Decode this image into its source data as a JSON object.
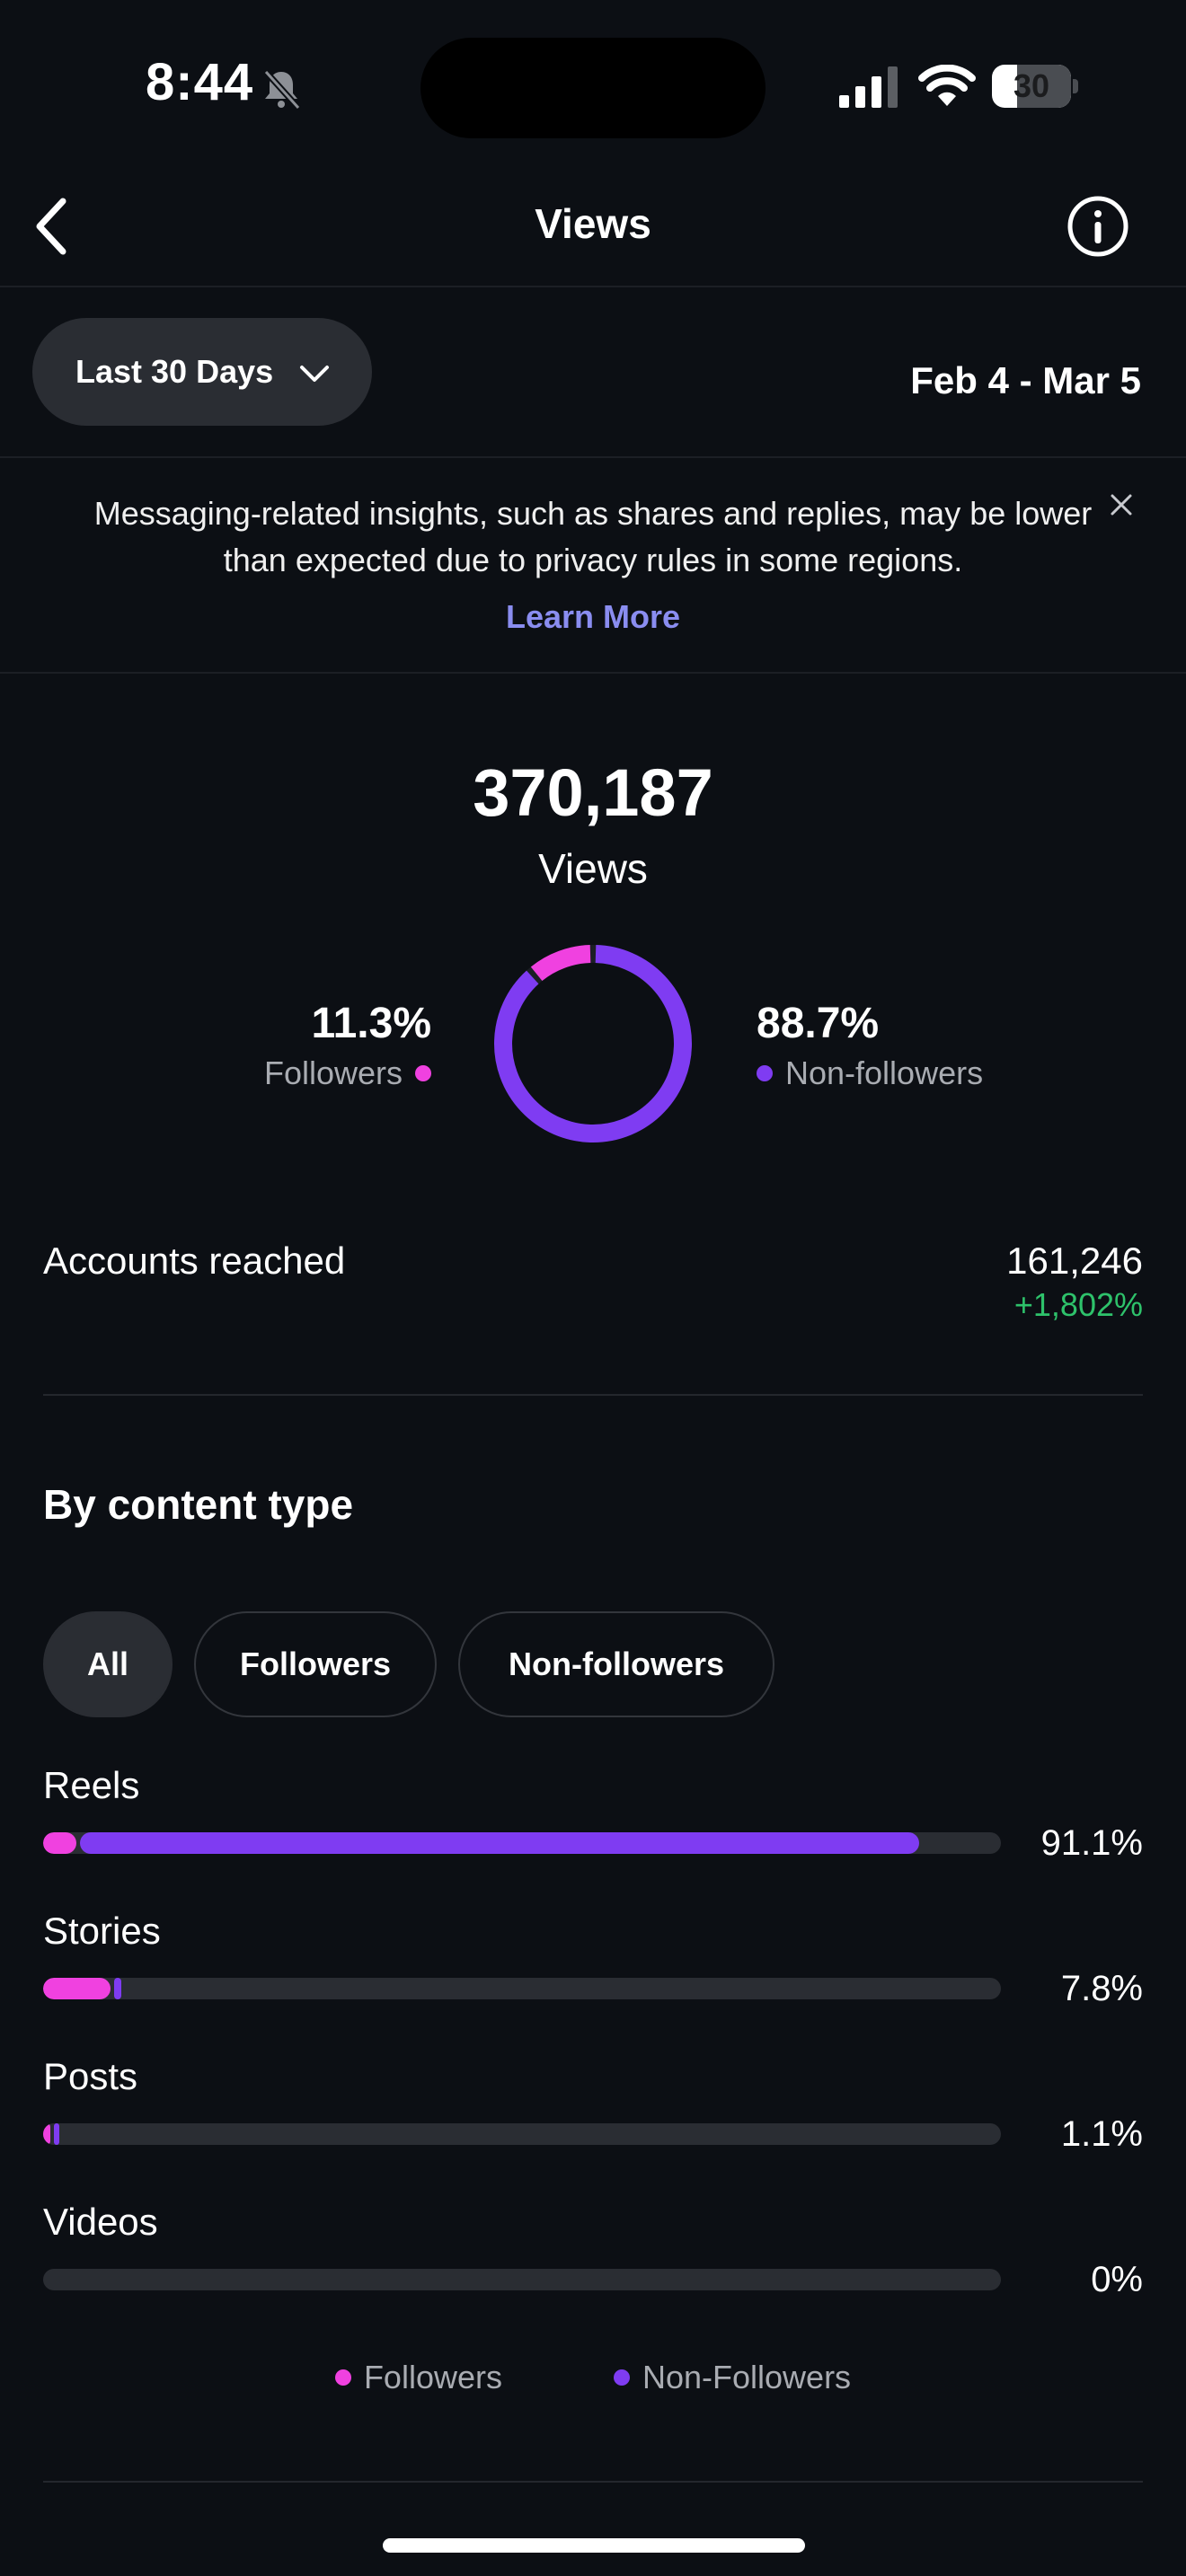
{
  "status_bar": {
    "time": "8:44",
    "battery": "30"
  },
  "header": {
    "title": "Views"
  },
  "filter": {
    "range_label": "Last 30 Days",
    "date_range": "Feb 4 - Mar 5"
  },
  "notice": {
    "text": "Messaging-related insights, such as shares and replies, may be lower than expected due to privacy rules in some regions.",
    "link": "Learn More"
  },
  "summary": {
    "total": "370,187",
    "total_label": "Views",
    "followers_pct": "11.3%",
    "followers_label": "Followers",
    "nonfollowers_pct": "88.7%",
    "nonfollowers_label": "Non-followers",
    "followers_fraction": 0.113
  },
  "accounts_reached": {
    "label": "Accounts reached",
    "value": "161,246",
    "change": "+1,802%"
  },
  "content_type": {
    "title": "By content type",
    "chips": [
      "All",
      "Followers",
      "Non-followers"
    ],
    "rows": [
      {
        "label": "Reels",
        "pct": "91.1%",
        "followers": 0.035,
        "non_followers": 0.876
      },
      {
        "label": "Stories",
        "pct": "7.8%",
        "followers": 0.07,
        "non_followers": 0.008
      },
      {
        "label": "Posts",
        "pct": "1.1%",
        "followers": 0.006,
        "non_followers": 0.005
      },
      {
        "label": "Videos",
        "pct": "0%",
        "followers": 0,
        "non_followers": 0
      }
    ],
    "legend": [
      "Followers",
      "Non-Followers"
    ]
  },
  "colors": {
    "followers": "#f041e0",
    "non_followers": "#7f3cf2",
    "positive": "#2ec26b",
    "link": "#8a8df0"
  }
}
